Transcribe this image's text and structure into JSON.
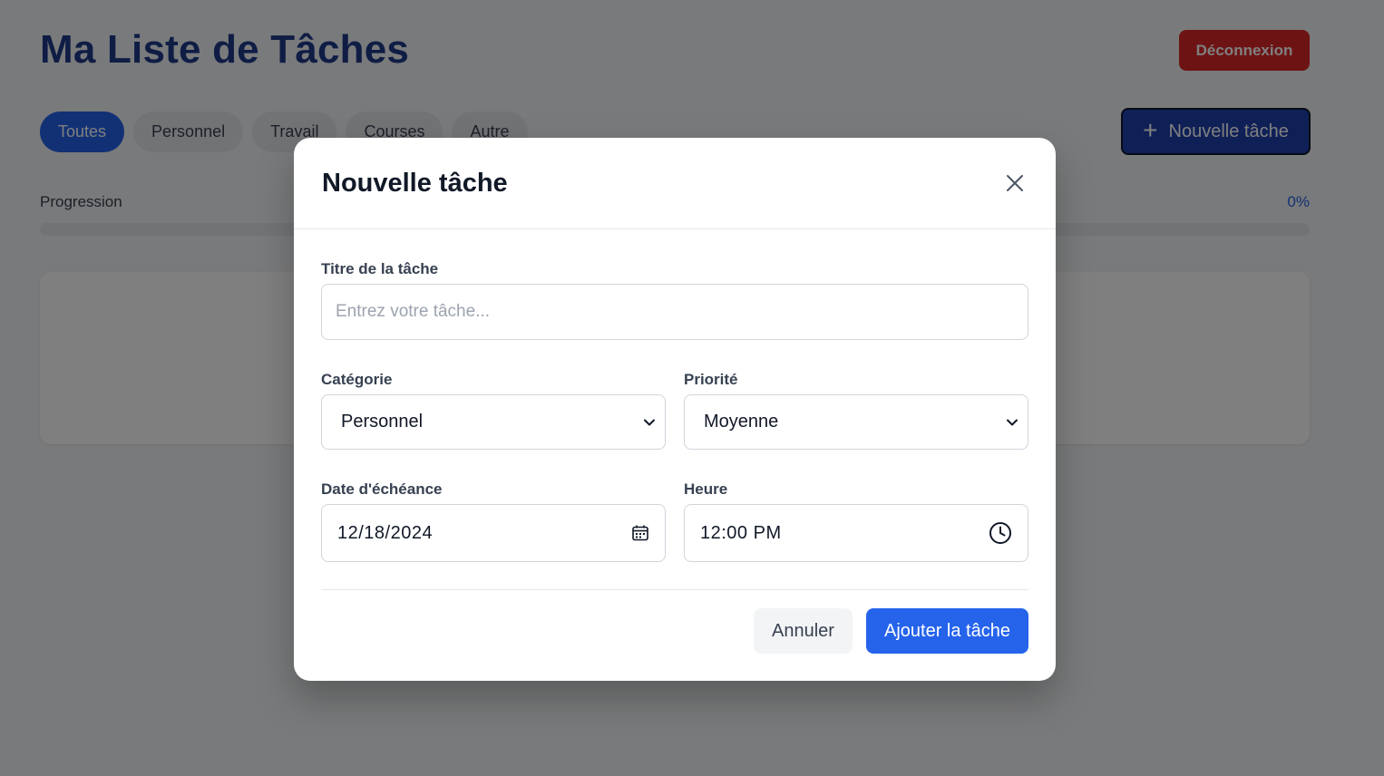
{
  "app": {
    "title": "Ma Liste de Tâches",
    "logout_label": "Déconnexion",
    "new_task_label": "Nouvelle tâche"
  },
  "filters": [
    {
      "label": "Toutes",
      "active": true
    },
    {
      "label": "Personnel",
      "active": false
    },
    {
      "label": "Travail",
      "active": false
    },
    {
      "label": "Courses",
      "active": false
    },
    {
      "label": "Autre",
      "active": false
    }
  ],
  "progress": {
    "label": "Progression",
    "value_text": "0%",
    "fraction": 0
  },
  "modal": {
    "title": "Nouvelle tâche",
    "title_field": {
      "label": "Titre de la tâche",
      "placeholder": "Entrez votre tâche...",
      "value": ""
    },
    "category": {
      "label": "Catégorie",
      "value": "Personnel"
    },
    "priority": {
      "label": "Priorité",
      "value": "Moyenne"
    },
    "due_date": {
      "label": "Date d'échéance",
      "value": "12/18/2024"
    },
    "time": {
      "label": "Heure",
      "value": "12:00 PM"
    },
    "cancel_label": "Annuler",
    "submit_label": "Ajouter la tâche"
  },
  "colors": {
    "primary": "#2563eb",
    "title": "#1e3a8a",
    "danger": "#dc2626"
  }
}
